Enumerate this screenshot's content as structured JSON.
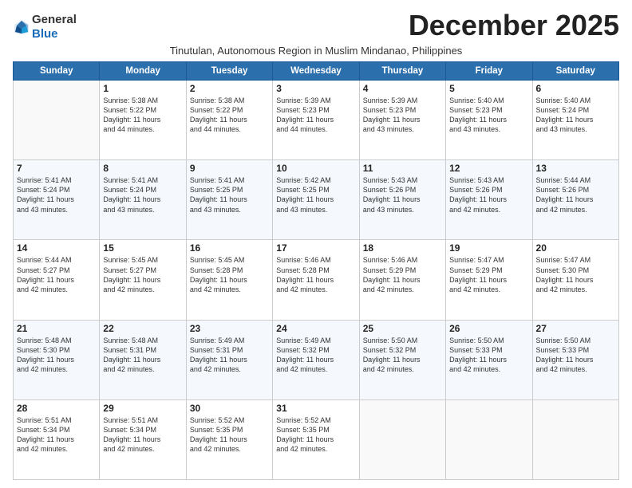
{
  "logo": {
    "general": "General",
    "blue": "Blue"
  },
  "header": {
    "month": "December 2025",
    "subtitle": "Tinutulan, Autonomous Region in Muslim Mindanao, Philippines"
  },
  "weekdays": [
    "Sunday",
    "Monday",
    "Tuesday",
    "Wednesday",
    "Thursday",
    "Friday",
    "Saturday"
  ],
  "weeks": [
    [
      {
        "day": "",
        "info": ""
      },
      {
        "day": "1",
        "info": "Sunrise: 5:38 AM\nSunset: 5:22 PM\nDaylight: 11 hours\nand 44 minutes."
      },
      {
        "day": "2",
        "info": "Sunrise: 5:38 AM\nSunset: 5:22 PM\nDaylight: 11 hours\nand 44 minutes."
      },
      {
        "day": "3",
        "info": "Sunrise: 5:39 AM\nSunset: 5:23 PM\nDaylight: 11 hours\nand 44 minutes."
      },
      {
        "day": "4",
        "info": "Sunrise: 5:39 AM\nSunset: 5:23 PM\nDaylight: 11 hours\nand 43 minutes."
      },
      {
        "day": "5",
        "info": "Sunrise: 5:40 AM\nSunset: 5:23 PM\nDaylight: 11 hours\nand 43 minutes."
      },
      {
        "day": "6",
        "info": "Sunrise: 5:40 AM\nSunset: 5:24 PM\nDaylight: 11 hours\nand 43 minutes."
      }
    ],
    [
      {
        "day": "7",
        "info": "Sunrise: 5:41 AM\nSunset: 5:24 PM\nDaylight: 11 hours\nand 43 minutes."
      },
      {
        "day": "8",
        "info": "Sunrise: 5:41 AM\nSunset: 5:24 PM\nDaylight: 11 hours\nand 43 minutes."
      },
      {
        "day": "9",
        "info": "Sunrise: 5:41 AM\nSunset: 5:25 PM\nDaylight: 11 hours\nand 43 minutes."
      },
      {
        "day": "10",
        "info": "Sunrise: 5:42 AM\nSunset: 5:25 PM\nDaylight: 11 hours\nand 43 minutes."
      },
      {
        "day": "11",
        "info": "Sunrise: 5:43 AM\nSunset: 5:26 PM\nDaylight: 11 hours\nand 43 minutes."
      },
      {
        "day": "12",
        "info": "Sunrise: 5:43 AM\nSunset: 5:26 PM\nDaylight: 11 hours\nand 42 minutes."
      },
      {
        "day": "13",
        "info": "Sunrise: 5:44 AM\nSunset: 5:26 PM\nDaylight: 11 hours\nand 42 minutes."
      }
    ],
    [
      {
        "day": "14",
        "info": "Sunrise: 5:44 AM\nSunset: 5:27 PM\nDaylight: 11 hours\nand 42 minutes."
      },
      {
        "day": "15",
        "info": "Sunrise: 5:45 AM\nSunset: 5:27 PM\nDaylight: 11 hours\nand 42 minutes."
      },
      {
        "day": "16",
        "info": "Sunrise: 5:45 AM\nSunset: 5:28 PM\nDaylight: 11 hours\nand 42 minutes."
      },
      {
        "day": "17",
        "info": "Sunrise: 5:46 AM\nSunset: 5:28 PM\nDaylight: 11 hours\nand 42 minutes."
      },
      {
        "day": "18",
        "info": "Sunrise: 5:46 AM\nSunset: 5:29 PM\nDaylight: 11 hours\nand 42 minutes."
      },
      {
        "day": "19",
        "info": "Sunrise: 5:47 AM\nSunset: 5:29 PM\nDaylight: 11 hours\nand 42 minutes."
      },
      {
        "day": "20",
        "info": "Sunrise: 5:47 AM\nSunset: 5:30 PM\nDaylight: 11 hours\nand 42 minutes."
      }
    ],
    [
      {
        "day": "21",
        "info": "Sunrise: 5:48 AM\nSunset: 5:30 PM\nDaylight: 11 hours\nand 42 minutes."
      },
      {
        "day": "22",
        "info": "Sunrise: 5:48 AM\nSunset: 5:31 PM\nDaylight: 11 hours\nand 42 minutes."
      },
      {
        "day": "23",
        "info": "Sunrise: 5:49 AM\nSunset: 5:31 PM\nDaylight: 11 hours\nand 42 minutes."
      },
      {
        "day": "24",
        "info": "Sunrise: 5:49 AM\nSunset: 5:32 PM\nDaylight: 11 hours\nand 42 minutes."
      },
      {
        "day": "25",
        "info": "Sunrise: 5:50 AM\nSunset: 5:32 PM\nDaylight: 11 hours\nand 42 minutes."
      },
      {
        "day": "26",
        "info": "Sunrise: 5:50 AM\nSunset: 5:33 PM\nDaylight: 11 hours\nand 42 minutes."
      },
      {
        "day": "27",
        "info": "Sunrise: 5:50 AM\nSunset: 5:33 PM\nDaylight: 11 hours\nand 42 minutes."
      }
    ],
    [
      {
        "day": "28",
        "info": "Sunrise: 5:51 AM\nSunset: 5:34 PM\nDaylight: 11 hours\nand 42 minutes."
      },
      {
        "day": "29",
        "info": "Sunrise: 5:51 AM\nSunset: 5:34 PM\nDaylight: 11 hours\nand 42 minutes."
      },
      {
        "day": "30",
        "info": "Sunrise: 5:52 AM\nSunset: 5:35 PM\nDaylight: 11 hours\nand 42 minutes."
      },
      {
        "day": "31",
        "info": "Sunrise: 5:52 AM\nSunset: 5:35 PM\nDaylight: 11 hours\nand 42 minutes."
      },
      {
        "day": "",
        "info": ""
      },
      {
        "day": "",
        "info": ""
      },
      {
        "day": "",
        "info": ""
      }
    ]
  ]
}
